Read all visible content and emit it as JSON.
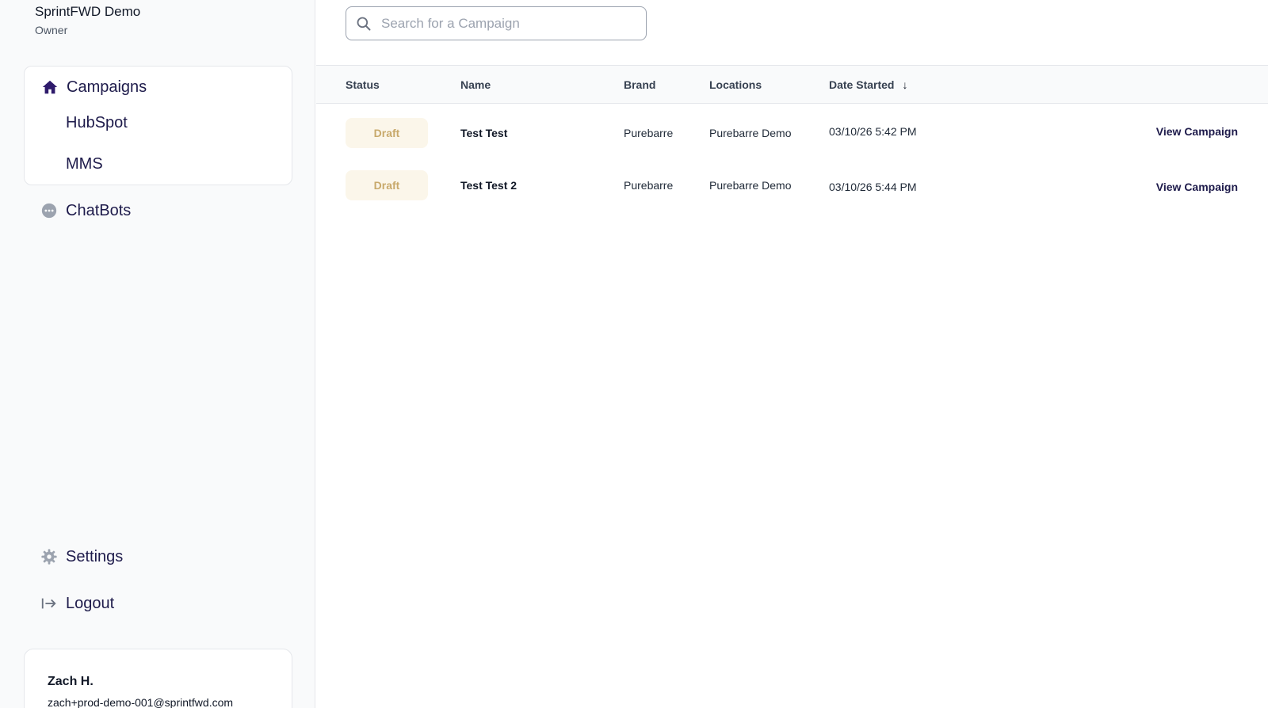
{
  "org": {
    "name": "SprintFWD Demo",
    "role": "Owner"
  },
  "nav": {
    "campaigns": {
      "label": "Campaigns",
      "icon": "home-icon"
    },
    "sub_items": [
      {
        "label": "HubSpot"
      },
      {
        "label": "MMS"
      }
    ],
    "chatbots": {
      "label": "ChatBots",
      "icon": "chat-bubble-icon"
    },
    "settings": {
      "label": "Settings",
      "icon": "gear-icon"
    },
    "logout": {
      "label": "Logout",
      "icon": "logout-icon"
    }
  },
  "user": {
    "name": "Zach H.",
    "email": "zach+prod-demo-001@sprintfwd.com"
  },
  "search": {
    "placeholder": "Search for a Campaign",
    "value": "",
    "icon": "search-icon"
  },
  "table": {
    "columns": {
      "status": "Status",
      "name": "Name",
      "brand": "Brand",
      "locations": "Locations",
      "date_started": "Date Started",
      "sort_arrow": "↓"
    },
    "rows": [
      {
        "status": "Draft",
        "name": "Test Test",
        "brand": "Purebarre",
        "locations": "Purebarre Demo",
        "date_started": "03/10/26 5:42 PM",
        "action": "View Campaign"
      },
      {
        "status": "Draft",
        "name": "Test Test 2",
        "brand": "Purebarre",
        "locations": "Purebarre Demo",
        "date_started": "03/10/26 5:44 PM",
        "action": "View Campaign"
      }
    ]
  },
  "colors": {
    "brand_primary": "#1e1b4b",
    "draft_badge_bg": "#fbf6ea",
    "draft_badge_text": "#c8a96b",
    "icon_gray": "#9ca3af"
  }
}
